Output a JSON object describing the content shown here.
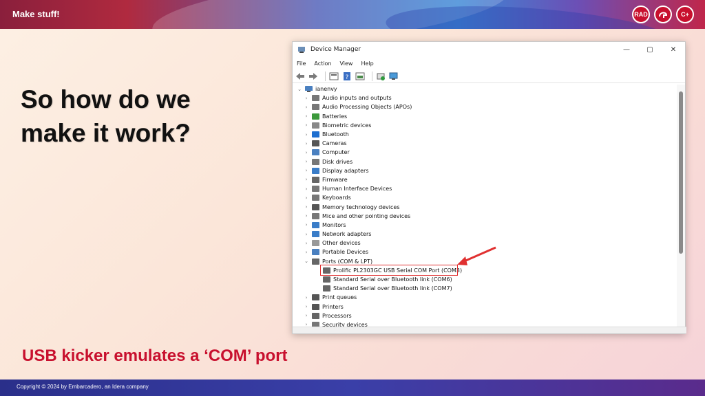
{
  "banner": {
    "title": "Make stuff!"
  },
  "logos": [
    "RAD",
    "",
    "C+"
  ],
  "headline": "So how do we make it work?",
  "caption": "USB kicker emulates a ‘COM’ port",
  "footer": {
    "text": "Copyright © 2024  by Embarcadero, an Idera company"
  },
  "colors": {
    "accent": "#c8102e",
    "highlight": "#e03030"
  },
  "device_manager": {
    "title": "Device Manager",
    "controls": [
      "—",
      "▢",
      "✕"
    ],
    "menu": [
      "File",
      "Action",
      "View",
      "Help"
    ],
    "root": "ianenvy",
    "items": [
      {
        "label": "Audio inputs and outputs",
        "icon": "audio-icon"
      },
      {
        "label": "Audio Processing Objects (APOs)",
        "icon": "audio-icon"
      },
      {
        "label": "Batteries",
        "icon": "battery-icon"
      },
      {
        "label": "Biometric devices",
        "icon": "biometric-icon"
      },
      {
        "label": "Bluetooth",
        "icon": "bluetooth-icon"
      },
      {
        "label": "Cameras",
        "icon": "camera-icon"
      },
      {
        "label": "Computer",
        "icon": "computer-icon"
      },
      {
        "label": "Disk drives",
        "icon": "disk-icon"
      },
      {
        "label": "Display adapters",
        "icon": "display-icon"
      },
      {
        "label": "Firmware",
        "icon": "firmware-icon"
      },
      {
        "label": "Human Interface Devices",
        "icon": "hid-icon"
      },
      {
        "label": "Keyboards",
        "icon": "keyboard-icon"
      },
      {
        "label": "Memory technology devices",
        "icon": "memory-icon"
      },
      {
        "label": "Mice and other pointing devices",
        "icon": "mouse-icon"
      },
      {
        "label": "Monitors",
        "icon": "monitor-icon"
      },
      {
        "label": "Network adapters",
        "icon": "network-icon"
      },
      {
        "label": "Other devices",
        "icon": "other-icon"
      },
      {
        "label": "Portable Devices",
        "icon": "portable-icon"
      },
      {
        "label": "Ports (COM & LPT)",
        "icon": "port-icon",
        "expanded": true
      },
      {
        "label": "Prolific PL2303GC USB Serial COM Port (COM3)",
        "icon": "port-icon",
        "child": true,
        "highlighted": true
      },
      {
        "label": "Standard Serial over Bluetooth link (COM6)",
        "icon": "port-icon",
        "child": true
      },
      {
        "label": "Standard Serial over Bluetooth link (COM7)",
        "icon": "port-icon",
        "child": true
      },
      {
        "label": "Print queues",
        "icon": "printer-icon"
      },
      {
        "label": "Printers",
        "icon": "printer-icon"
      },
      {
        "label": "Processors",
        "icon": "cpu-icon"
      },
      {
        "label": "Security devices",
        "icon": "security-icon"
      }
    ]
  }
}
